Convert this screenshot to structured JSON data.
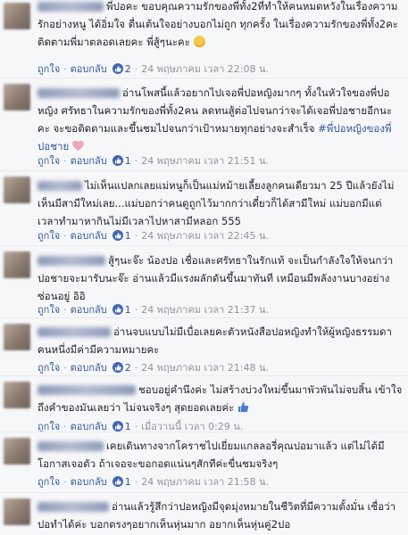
{
  "comments": [
    {
      "text": "พี่ปอคะ ขอบคุณความรักของพี่ทั้ง2ที่ทำให้คนหมดหวังในเรื่องความรักอย่างหนู ได้อิ่มใจ ตื่นเต้นใจอย่างบอกไม่ถูก ทุกครั้ง ในเรื่องความรักของพี่ทั้ง2คะ ติดตามพี่มาตลอดเลยคะ พี่สู้ๆนะคะ",
      "emoji": "smiling-face-with-heart-eyes",
      "reply_label": "ถูกใจ",
      "answer_label": "ตอบกลับ",
      "likes": "2",
      "timestamp": "24 พฤษภาคม เวลา 22:08 น."
    },
    {
      "text": "อ่านโพสนี้แล้วอยากไปเจอพี่ปอหญิงมากๆ ทั้งในหัวใจของพี่ปอหญิง ศรัทธาในความรักของพี่ทั้ง2คน ลดทนสู้ต่อไปจนกว่าจะได้เจอพี่ปอชายอีกนะคะ จะขอติดตามและขึ้นชมไปจนกว่าเป้าหมายทุกอย่างจะสำเร็จ",
      "hashtag": "#พี่ปอหญิงของพี่ปอชาย",
      "emoji": "heart",
      "reply_label": "ถูกใจ",
      "answer_label": "ตอบกลับ",
      "likes": "1",
      "timestamp": "24 พฤษภาคม เวลา 21:51 น."
    },
    {
      "text": "ไม่เห็นแปลกเลยแม่หนูก็เป็นแม่หม้ายเลี้ยงลูกคนเดียวมา 25 ปีแล้วยังไม่เห็นมีสามีใหม่เลย...แม่บอกว่าคนดูถูกไว้มากกว่าเดี๋ยวก็ได้สามีใหม่ แม่บอกมีแต่เวลาทำมาหากินไม่มีเวลาไปหาสามีหลอก 555",
      "reply_label": "ถูกใจ",
      "answer_label": "ตอบกลับ",
      "likes": "1",
      "timestamp": "24 พฤษภาคม เวลา 22:45 น."
    },
    {
      "text": "สู้ๆนะจ๊ะ น้องปอ เชื่อและศรัทธาในรักแท้ จะเป็นกำลังใจให้จนกว่าปอชายจะมารับนะจ๊ะ อ่านแล้วมีแรงผลักดันขึ้นมาทันที เหมือนมีพลังงานบางอย่างซ่อนอยู่ อิอิ",
      "reply_label": "ถูกใจ",
      "answer_label": "ตอบกลับ",
      "likes": "1",
      "timestamp": "24 พฤษภาคม เวลา 21:37 น."
    },
    {
      "text": "อ่านจบแบบไม่มีเบื่อเลยคะตัวหนังสือปอหญิงทำให้ผู้หญิงธรรมดาคนหนึ่งมีค่ามีความหมายคะ",
      "reply_label": "ถูกใจ",
      "answer_label": "ตอบกลับ",
      "likes": "2",
      "timestamp": "24 พฤษภาคม เวลา 21:48 น."
    },
    {
      "text": "ชอบอยู่คำนึงค่ะ ไม่สร้างบ่วงใหม่ขึ้นมาพัวพันไม่จบสิ้น เข้าใจถึงคำของมันเลยว่า ไม่จนจริงๆ สุดยอดเลยค่ะ",
      "emoji": "thumbs-up",
      "reply_label": "ถูกใจ",
      "answer_label": "ตอบกลับ",
      "likes": "1",
      "timestamp": "เมื่อวานนี้ เวลา 0:29 น."
    },
    {
      "text": "เคยเดินทางจากโคราชไปเยี่ยมแกลลอรี่คุณปอมาแล้ว แต่ไม่ได้มีโอกาสเจอตัว ถ้าเจอจะขอกอดแน่นๆสักทีค่ะขื่นชมจริงๆ",
      "reply_label": "ถูกใจ",
      "answer_label": "ตอบกลับ",
      "likes": "1",
      "timestamp": "24 พฤษภาคม เวลา 21:58 น."
    },
    {
      "text": "อ่านแล้วรู้สึกว่าปอหญิงมีจุดมุ่งหมายในชีวิตที่มีความตั้งมั่น เชื่อว่าปอทำได้ค่ะ บอกตรงๆอยากเห็นหุ่นมาก อยากเห็นหุ่นคู่2ปอ"
    }
  ]
}
